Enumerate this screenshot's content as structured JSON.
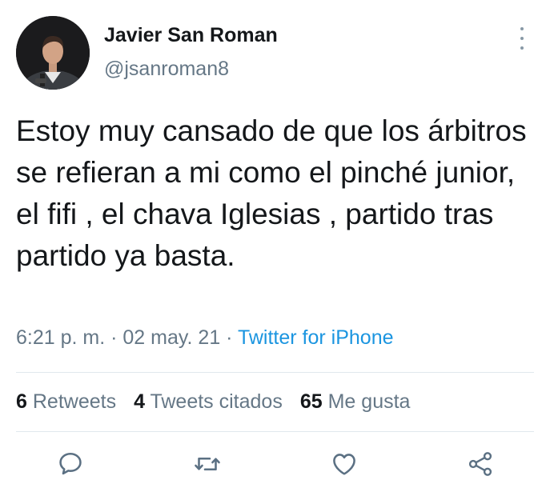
{
  "user": {
    "name": "Javier San Roman",
    "handle": "@jsanroman8"
  },
  "tweet": {
    "text": "Estoy muy cansado de que los árbitros se refieran a mi como el pinché junior, el fifi , el chava Iglesias , partido tras partido ya basta."
  },
  "meta": {
    "time": "6:21 p. m.",
    "sep1": " · ",
    "date": "02 may. 21",
    "sep2": " · ",
    "source": "Twitter for iPhone"
  },
  "stats": {
    "retweets_count": "6",
    "retweets_label": "Retweets",
    "quotes_count": "4",
    "quotes_label": "Tweets citados",
    "likes_count": "65",
    "likes_label": "Me gusta"
  },
  "icons": {
    "more": "more-vertical-icon",
    "reply": "reply-icon",
    "retweet": "retweet-icon",
    "like": "heart-icon",
    "share": "share-icon"
  },
  "colors": {
    "text": "#14171a",
    "secondary": "#657786",
    "link": "#1b95e0",
    "divider": "#e1e8ed",
    "icon": "#5b7083"
  }
}
